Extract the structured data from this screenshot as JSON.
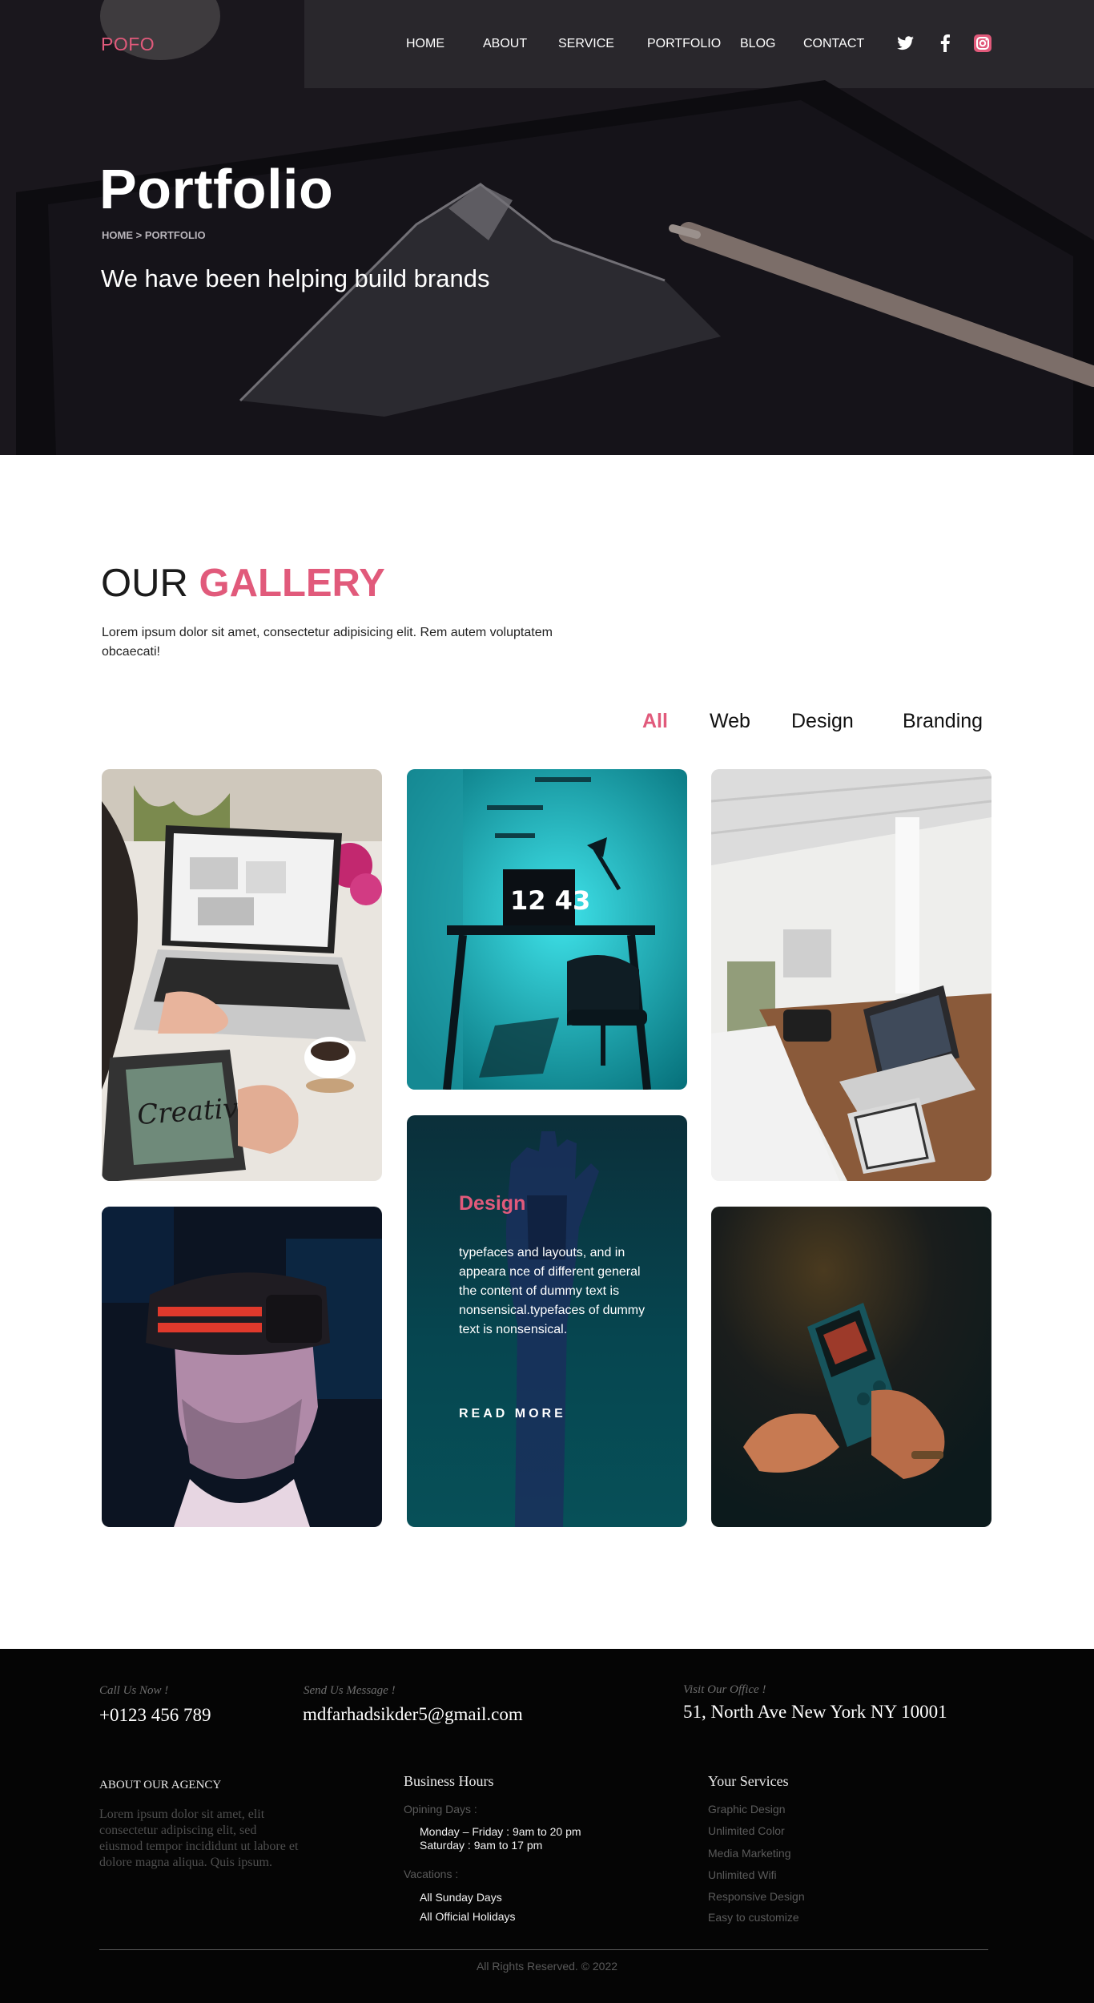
{
  "colors": {
    "accent": "#e15a7b",
    "footer_bg": "#050505",
    "design_card_bg": "#064650"
  },
  "header": {
    "brand": "POFO",
    "nav": [
      {
        "label": "HOME",
        "id": "home"
      },
      {
        "label": "ABOUT",
        "id": "about"
      },
      {
        "label": "SERVICE",
        "id": "service"
      },
      {
        "label": "PORTFOLIO",
        "id": "portfolio"
      },
      {
        "label": "BLOG",
        "id": "blog"
      },
      {
        "label": "CONTACT",
        "id": "contact"
      }
    ],
    "social_icons": [
      "twitter-icon",
      "facebook-icon",
      "instagram-icon"
    ]
  },
  "hero": {
    "title": "Portfolio",
    "breadcrumb": "HOME > PORTFOLIO",
    "subtitle": "We have been helping build brands"
  },
  "gallery": {
    "heading_plain": "OUR",
    "heading_accent": "GALLERY",
    "description": "Lorem ipsum dolor sit amet, consectetur adipisicing elit. Rem autem voluptatem obcaecati!",
    "filters": [
      {
        "label": "All",
        "active": true
      },
      {
        "label": "Web",
        "active": false
      },
      {
        "label": "Design",
        "active": false
      },
      {
        "label": "Branding",
        "active": false
      }
    ],
    "images": [
      {
        "name": "laptop-creative-photo",
        "description": "Person typing on laptop with tablet reading Creative"
      },
      {
        "name": "neon-desk-photo",
        "description": "Cyan lit desk with monitor showing 12 43"
      },
      {
        "name": "office-laptop-photo",
        "description": "Bright office with laptop and camera on wooden desk"
      },
      {
        "name": "vr-headset-photo",
        "description": "Man wearing VR headset with red light strip"
      },
      {
        "name": "handheld-console-photo",
        "description": "Hands holding handheld game console"
      }
    ],
    "monitor_text": "12 43",
    "tablet_text": "Creative",
    "design_card": {
      "title": "Design",
      "text": "typefaces and layouts, and in appeara nce of different general the content of dummy text is nonsensical.typefaces of dummy text is nonsensical.",
      "cta": "READ MORE"
    }
  },
  "footer": {
    "call": {
      "label": "Call Us Now !",
      "value": "+0123 456 789"
    },
    "message": {
      "label": "Send Us Message !",
      "value": "mdfarhadsikder5@gmail.com"
    },
    "office": {
      "label": "Visit Our Office !",
      "value": "51, North Ave New York NY 10001"
    },
    "about": {
      "heading": "ABOUT OUR AGENCY",
      "text": "Lorem ipsum dolor sit amet, elit consectetur adipiscing elit, sed eiusmod tempor incididunt ut labore et dolore magna aliqua. Quis ipsum."
    },
    "hours": {
      "heading": "Business Hours",
      "opening_label": "Opining Days :",
      "opening_line1": "Monday – Friday : 9am to 20 pm",
      "opening_line2": "Saturday : 9am to 17 pm",
      "vacation_label": "Vacations :",
      "vacation_line1": "All Sunday Days",
      "vacation_line2": "All Official Holidays"
    },
    "services": {
      "heading": "Your  Services",
      "items": [
        "Graphic Design",
        "Unlimited Color",
        "Media Marketing",
        "Unlimited Wifi",
        "Responsive Design",
        "Easy to customize"
      ]
    },
    "copyright": "All Rights Reserved. © 2022"
  }
}
